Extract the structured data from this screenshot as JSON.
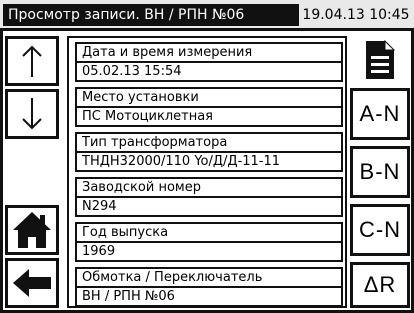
{
  "titlebar": {
    "title": "Просмотр записи. ВН / РПН №06",
    "datetime": "19.04.13 10:45"
  },
  "fields": [
    {
      "label": "Дата и время измерения",
      "value": "05.02.13 15:54"
    },
    {
      "label": "Место установки",
      "value": "ПС Мотоциклетная"
    },
    {
      "label": "Тип трансформатора",
      "value": "ТНДН32000/110 Yo/Д/Д-11-11"
    },
    {
      "label": "Заводской номер",
      "value": "N294"
    },
    {
      "label": "Год выпуска",
      "value": "1969"
    },
    {
      "label": "Обмотка / Переключатель",
      "value": "ВН / РПН №06"
    }
  ],
  "side_buttons": {
    "a": "A-N",
    "b": "B-N",
    "c": "C-N",
    "r": "ΔR"
  },
  "icons": {
    "up": "arrow-up-icon",
    "down": "arrow-down-icon",
    "home": "home-icon",
    "back": "arrow-left-icon",
    "document": "document-icon"
  }
}
